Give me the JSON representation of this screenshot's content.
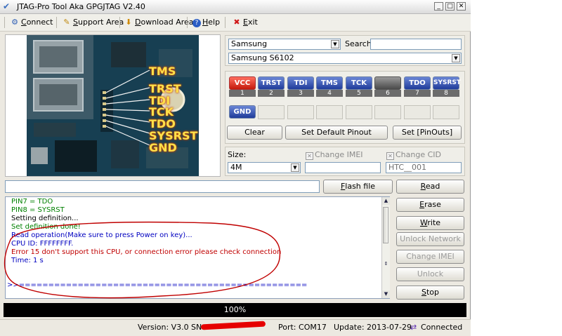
{
  "window": {
    "title": "JTAG-Pro Tool Aka GPGJTAG V2.40",
    "controls": {
      "minimize": "_",
      "maximize": "□",
      "close": "✕"
    }
  },
  "toolbar": {
    "connect": {
      "accel": "C",
      "rest": "onnect"
    },
    "support": {
      "accel": "S",
      "rest": "upport Area"
    },
    "download": {
      "accel": "D",
      "rest": "ownload Area"
    },
    "help": {
      "accel": "H",
      "rest": "elp"
    },
    "exit": {
      "accel": "E",
      "rest": "xit"
    }
  },
  "board_labels": [
    "TMS",
    "TRST",
    "TDI",
    "TCK",
    "TDO",
    "SYSRST",
    "GND"
  ],
  "device": {
    "brand": "Samsung",
    "search_label": "Search:",
    "search_value": "",
    "model": "Samsung S6102"
  },
  "pins": [
    {
      "name": "VCC",
      "num": "1"
    },
    {
      "name": "TRST",
      "num": "2"
    },
    {
      "name": "TDI",
      "num": "3"
    },
    {
      "name": "TMS",
      "num": "4"
    },
    {
      "name": "TCK",
      "num": "5"
    },
    {
      "name": "",
      "num": "6"
    },
    {
      "name": "TDO",
      "num": "7"
    },
    {
      "name": "SYSRST",
      "num": "8"
    }
  ],
  "gnd_pin": "GND",
  "pin_buttons": {
    "clear": "Clear",
    "default": "Set Default Pinout",
    "set": "Set [PinOuts]"
  },
  "size": {
    "label": "Size:",
    "value": "4M"
  },
  "imei": {
    "label": "Change IMEI",
    "value": ""
  },
  "cid": {
    "label": "Change CID",
    "value": "HTC__001"
  },
  "flash": {
    "path": "",
    "button_accel": "F",
    "button_rest": "lash file"
  },
  "actions": {
    "read": {
      "accel": "R",
      "rest": "ead"
    },
    "erase": {
      "accel": "E",
      "rest": "rase"
    },
    "write": {
      "accel": "W",
      "rest": "rite"
    },
    "unlock_network": "Unlock Network",
    "change_imei": "Change IMEI",
    "unlock": "Unlock",
    "stop": {
      "accel": "S",
      "rest": "top"
    }
  },
  "log": [
    {
      "text": "PIN7 = TDO",
      "color": "#008000"
    },
    {
      "text": "PIN8 = SYSRST",
      "color": "#008000"
    },
    {
      "text": "Setting definition...",
      "color": "#000000"
    },
    {
      "text": "Set definition done!",
      "color": "#008000"
    },
    {
      "text": "Read operation(Make sure to press Power on key)...",
      "color": "#0000c0"
    },
    {
      "text": "CPU    ID: FFFFFFFF.",
      "color": "#0000c0"
    },
    {
      "text": "Error 15 don't support this CPU, or connection error please check connection",
      "color": "#c00000"
    },
    {
      "text": "Time: 1 s",
      "color": "#0000c0"
    },
    {
      "text": "",
      "color": "#000000"
    },
    {
      "text": ">>=================================================",
      "color": "#0000c0"
    }
  ],
  "progress": {
    "text": "100%",
    "value": 100
  },
  "status": {
    "version": "Version: V3.0",
    "sn_label": "SN:",
    "port": "Port: COM17",
    "update": "Update: 2013-07-29",
    "connection": "Connected"
  },
  "colors": {
    "annotation": "#c00000",
    "progress_bg": "#000000",
    "pin_blue": "#2d4aa8",
    "pin_red": "#d2281a"
  }
}
